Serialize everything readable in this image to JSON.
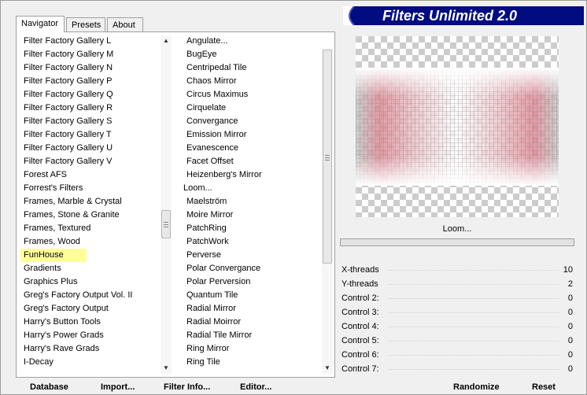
{
  "banner_title": "Filters Unlimited 2.0",
  "tabs": [
    "Navigator",
    "Presets",
    "About"
  ],
  "categories": [
    "Filter Factory Gallery L",
    "Filter Factory Gallery M",
    "Filter Factory Gallery N",
    "Filter Factory Gallery P",
    "Filter Factory Gallery Q",
    "Filter Factory Gallery R",
    "Filter Factory Gallery S",
    "Filter Factory Gallery T",
    "Filter Factory Gallery U",
    "Filter Factory Gallery V",
    "Forest AFS",
    "Forrest's Filters",
    "Frames, Marble & Crystal",
    "Frames, Stone & Granite",
    "Frames, Textured",
    "Frames, Wood",
    "FunHouse",
    "Gradients",
    "Graphics Plus",
    "Greg's Factory Output Vol. II",
    "Greg's Factory Output",
    "Harry's Button Tools",
    "Harry's Power Grads",
    "Harry's Rave Grads",
    "I-Decay"
  ],
  "selected_category": "FunHouse",
  "filters": [
    "Angulate...",
    "BugEye",
    "Centripedal Tile",
    "Chaos Mirror",
    "Circus Maximus",
    "Cirquelate",
    "Convergance",
    "Emission Mirror",
    "Evanescence",
    "Facet Offset",
    "Heizenberg's Mirror",
    "Loom...",
    "Maelström",
    "Moire Mirror",
    "PatchRing",
    "PatchWork",
    "Perverse",
    "Polar Convergance",
    "Polar Perversion",
    "Quantum Tile",
    "Radial Mirror",
    "Radial Moirror",
    "Radial Tile Mirror",
    "Ring Mirror",
    "Ring Tile"
  ],
  "selected_filter": "Loom...",
  "filter_name": "Loom...",
  "controls": [
    {
      "label": "X-threads",
      "value": "10"
    },
    {
      "label": "Y-threads",
      "value": "2"
    },
    {
      "label": "Control 2:",
      "value": "0"
    },
    {
      "label": "Control 3:",
      "value": "0"
    },
    {
      "label": "Control 4:",
      "value": "0"
    },
    {
      "label": "Control 5:",
      "value": "0"
    },
    {
      "label": "Control 6:",
      "value": "0"
    },
    {
      "label": "Control 7:",
      "value": "0"
    }
  ],
  "bottom_buttons": [
    "Database",
    "Import...",
    "Filter Info...",
    "Editor...",
    "Randomize",
    "Reset"
  ],
  "colors": {
    "banner": "#000c80",
    "highlight_yellow": "#ffff99",
    "select_blue": "#3399ff"
  }
}
